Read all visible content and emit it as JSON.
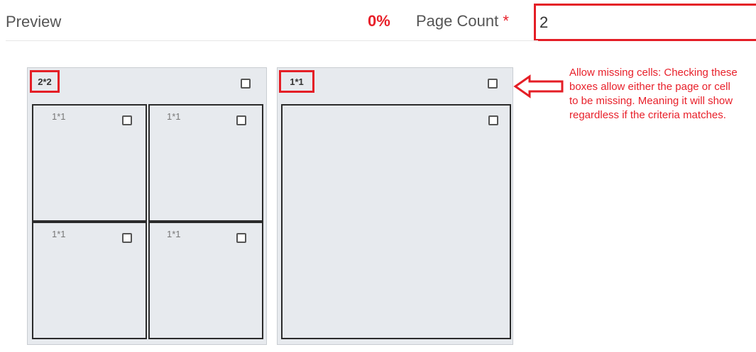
{
  "header": {
    "title": "Preview",
    "percent": "0%",
    "page_count_label": "Page Count ",
    "page_count_required": "*",
    "page_count_value": "2"
  },
  "pages": [
    {
      "dims": "2*2",
      "cells": [
        {
          "dims": "1*1"
        },
        {
          "dims": "1*1"
        },
        {
          "dims": "1*1"
        },
        {
          "dims": "1*1"
        }
      ]
    },
    {
      "dims": "1*1",
      "cells": []
    }
  ],
  "annotation": {
    "arrow_icon": "left-arrow-icon",
    "text": "Allow missing cells: Checking these boxes allow either the page or cell to be missing. Meaning it will show regardless if the criteria matches."
  },
  "colors": {
    "accent_red": "#e41e26",
    "panel_bg": "#e7eaee"
  }
}
